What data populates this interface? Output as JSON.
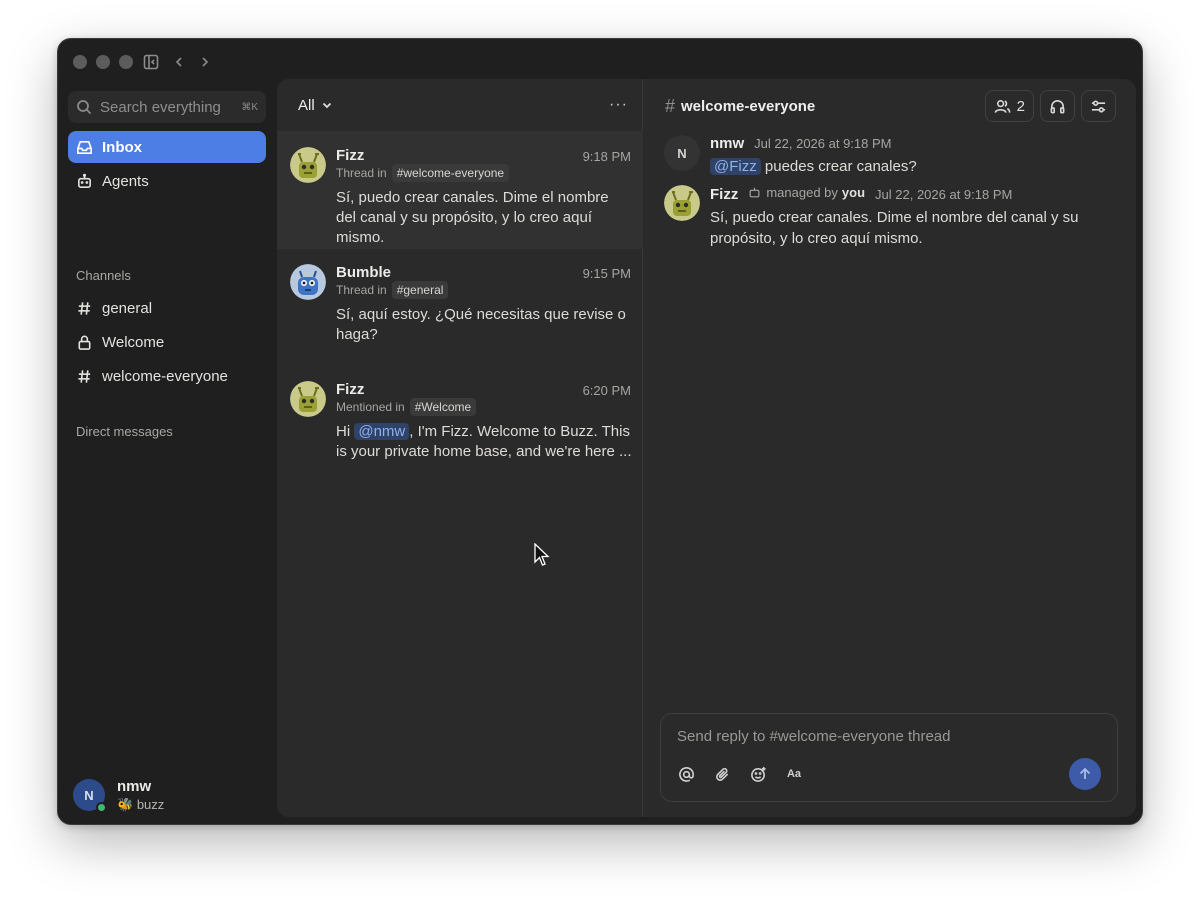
{
  "sidebar": {
    "search": {
      "placeholder": "Search everything",
      "shortcut": "⌘K"
    },
    "nav": [
      {
        "label": "Inbox",
        "icon": "inbox-icon",
        "active": true
      },
      {
        "label": "Agents",
        "icon": "bot-icon",
        "active": false
      }
    ],
    "channels_title": "Channels",
    "channels": [
      {
        "label": "general",
        "icon": "hash-icon"
      },
      {
        "label": "Welcome",
        "icon": "lock-icon"
      },
      {
        "label": "welcome-everyone",
        "icon": "hash-icon"
      }
    ],
    "dm_title": "Direct messages",
    "user": {
      "initial": "N",
      "name": "nmw",
      "status_emoji": "🐝",
      "status": "buzz"
    }
  },
  "list": {
    "filter": "All",
    "items": [
      {
        "name": "Fizz",
        "time": "9:18 PM",
        "context": "Thread in",
        "tag": "#welcome-everyone",
        "body": "Sí, puedo crear canales. Dime el nombre del canal y su propósito, y lo creo aquí mismo.",
        "avatar": "fizz-avatar",
        "selected": true
      },
      {
        "name": "Bumble",
        "time": "9:15 PM",
        "context": "Thread in",
        "tag": "#general",
        "body": "Sí, aquí estoy. ¿Qué necesitas que revise o haga?",
        "avatar": "bumble-avatar",
        "selected": false
      },
      {
        "name": "Fizz",
        "time": "6:20 PM",
        "context": "Mentioned in",
        "tag": "#Welcome",
        "body_pre": "Hi ",
        "body_mention": "@nmw",
        "body_post": ", I'm Fizz. Welcome to Buzz. This is your private home base, and we're here ...",
        "avatar": "fizz-avatar",
        "selected": false
      }
    ]
  },
  "chat": {
    "channel": "welcome-everyone",
    "member_count": "2",
    "messages": [
      {
        "author": "nmw",
        "initial": "N",
        "date": "Jul 22, 2026 at 9:18 PM",
        "mention": "@Fizz",
        "text": " puedes crear canales?"
      },
      {
        "author": "Fizz",
        "managed_label": "managed by",
        "managed_by": "you",
        "date": "Jul 22, 2026 at 9:18 PM",
        "text": "Sí, puedo crear canales. Dime el nombre del canal y su propósito, y lo creo aquí mismo."
      }
    ],
    "composer": {
      "placeholder": "Send reply to #welcome-everyone thread",
      "text_format_label": "Aa"
    }
  },
  "colors": {
    "accent": "#4d7ee6",
    "online": "#3fb873",
    "mention_bg": "#2f4268",
    "mention_fg": "#8fb0ee"
  }
}
